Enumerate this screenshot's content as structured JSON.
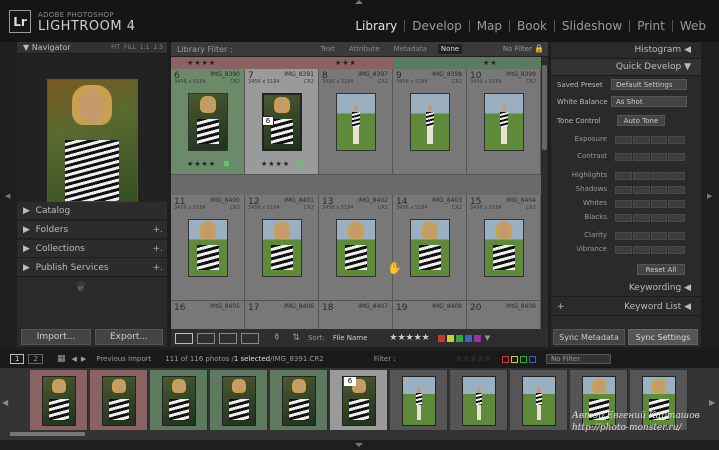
{
  "app": {
    "logo": "Lr",
    "brand_top": "ADOBE PHOTOSHOP",
    "brand_main": "LIGHTROOM 4"
  },
  "modules": [
    "Library",
    "Develop",
    "Map",
    "Book",
    "Slideshow",
    "Print",
    "Web"
  ],
  "navigator": {
    "title": "Navigator",
    "options": "FIT  FILL  1:1  1:3"
  },
  "left_sections": [
    "Catalog",
    "Folders",
    "Collections",
    "Publish Services"
  ],
  "buttons": {
    "import": "Import...",
    "export": "Export..."
  },
  "filter": {
    "label": "Library Filter :",
    "tabs": [
      "Text",
      "Attribute",
      "Metadata",
      "None"
    ],
    "preset": "No Filter"
  },
  "grid": {
    "top_row": [
      "★★★★",
      "",
      "★★★",
      "",
      "★★"
    ],
    "cells": [
      {
        "num": "6",
        "name": "IMG_8390",
        "dim": "3456 x 5184",
        "ext": "CR2",
        "stars": "★★★★"
      },
      {
        "num": "7",
        "name": "IMG_8391",
        "dim": "3456 x 5184",
        "ext": "CR2",
        "stars": "★★★★"
      },
      {
        "num": "8",
        "name": "IMG_8397",
        "dim": "3456 x 5184",
        "ext": "CR2",
        "stars": ""
      },
      {
        "num": "9",
        "name": "IMG_8398",
        "dim": "3456 x 5184",
        "ext": "CR2",
        "stars": ""
      },
      {
        "num": "10",
        "name": "IMG_8399",
        "dim": "3456 x 5184",
        "ext": "CR2",
        "stars": ""
      },
      {
        "num": "11",
        "name": "IMG_8400",
        "dim": "3456 x 5184",
        "ext": "CR2",
        "stars": ""
      },
      {
        "num": "12",
        "name": "IMG_8401",
        "dim": "3456 x 5184",
        "ext": "CR2",
        "stars": ""
      },
      {
        "num": "13",
        "name": "IMG_8402",
        "dim": "3456 x 5184",
        "ext": "CR2",
        "stars": ""
      },
      {
        "num": "14",
        "name": "IMG_8403",
        "dim": "3456 x 5184",
        "ext": "CR2",
        "stars": ""
      },
      {
        "num": "15",
        "name": "IMG_8404",
        "dim": "3456 x 5184",
        "ext": "CR2",
        "stars": ""
      },
      {
        "num": "16",
        "name": "IMG_8405",
        "dim": "",
        "ext": "",
        "stars": ""
      },
      {
        "num": "17",
        "name": "IMG_8406",
        "dim": "",
        "ext": "",
        "stars": ""
      },
      {
        "num": "18",
        "name": "IMG_8407",
        "dim": "",
        "ext": "",
        "stars": ""
      },
      {
        "num": "19",
        "name": "IMG_8408",
        "dim": "",
        "ext": "",
        "stars": ""
      },
      {
        "num": "20",
        "name": "IMG_8409",
        "dim": "",
        "ext": "",
        "stars": ""
      }
    ],
    "selected_badge": "6"
  },
  "toolbar": {
    "sort_label": "Sort:",
    "sort_value": "File Name",
    "stars": "★★★★★"
  },
  "right": {
    "histogram": "Histogram",
    "quick_develop": "Quick Develop",
    "saved_preset_label": "Saved Preset",
    "saved_preset_value": "Default Settings",
    "white_balance_label": "White Balance",
    "white_balance_value": "As Shot",
    "tone_control_label": "Tone Control",
    "auto_tone": "Auto Tone",
    "adjustments": [
      "Exposure",
      "Contrast",
      "Highlights",
      "Shadows",
      "Whites",
      "Blacks",
      "Clarity",
      "Vibrance"
    ],
    "reset_all": "Reset All",
    "keywording": "Keywording",
    "keyword_list": "Keyword List",
    "sync_metadata": "Sync Metadata",
    "sync_settings": "Sync Settings"
  },
  "filmbar": {
    "page1": "1",
    "page2": "2",
    "previous": "Previous Import",
    "count": "111 of 116 photos / ",
    "selected": "1 selected",
    "file": " /IMG_8391.CR2",
    "filter_label": "Filter :",
    "filter_value": "No Filter"
  },
  "watermark": {
    "line1": "Автор Евгений Карташов",
    "line2": "http://photo-monster.ru/"
  },
  "filmstrip_badge": "6"
}
